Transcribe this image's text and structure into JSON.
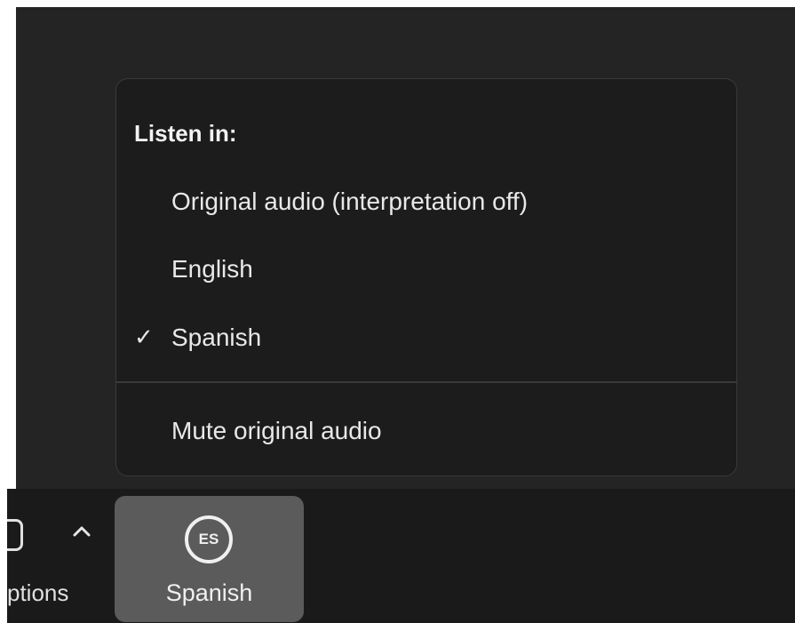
{
  "menu": {
    "header": "Listen in:",
    "items": [
      {
        "label": "Original audio (interpretation off)",
        "checked": false
      },
      {
        "label": "English",
        "checked": false
      },
      {
        "label": "Spanish",
        "checked": true
      }
    ],
    "check_glyph": "✓",
    "mute_label": "Mute original audio"
  },
  "toolbar": {
    "partial_label": "ptions",
    "interpretation": {
      "badge": "ES",
      "label": "Spanish"
    },
    "caret_icon": "chevron-up-icon"
  },
  "colors": {
    "background": "#242424",
    "menu_bg": "#1c1c1c",
    "toolbar_bg": "#1a1a1a",
    "active_button": "#5b5b5b",
    "text": "#e8e8e8"
  }
}
